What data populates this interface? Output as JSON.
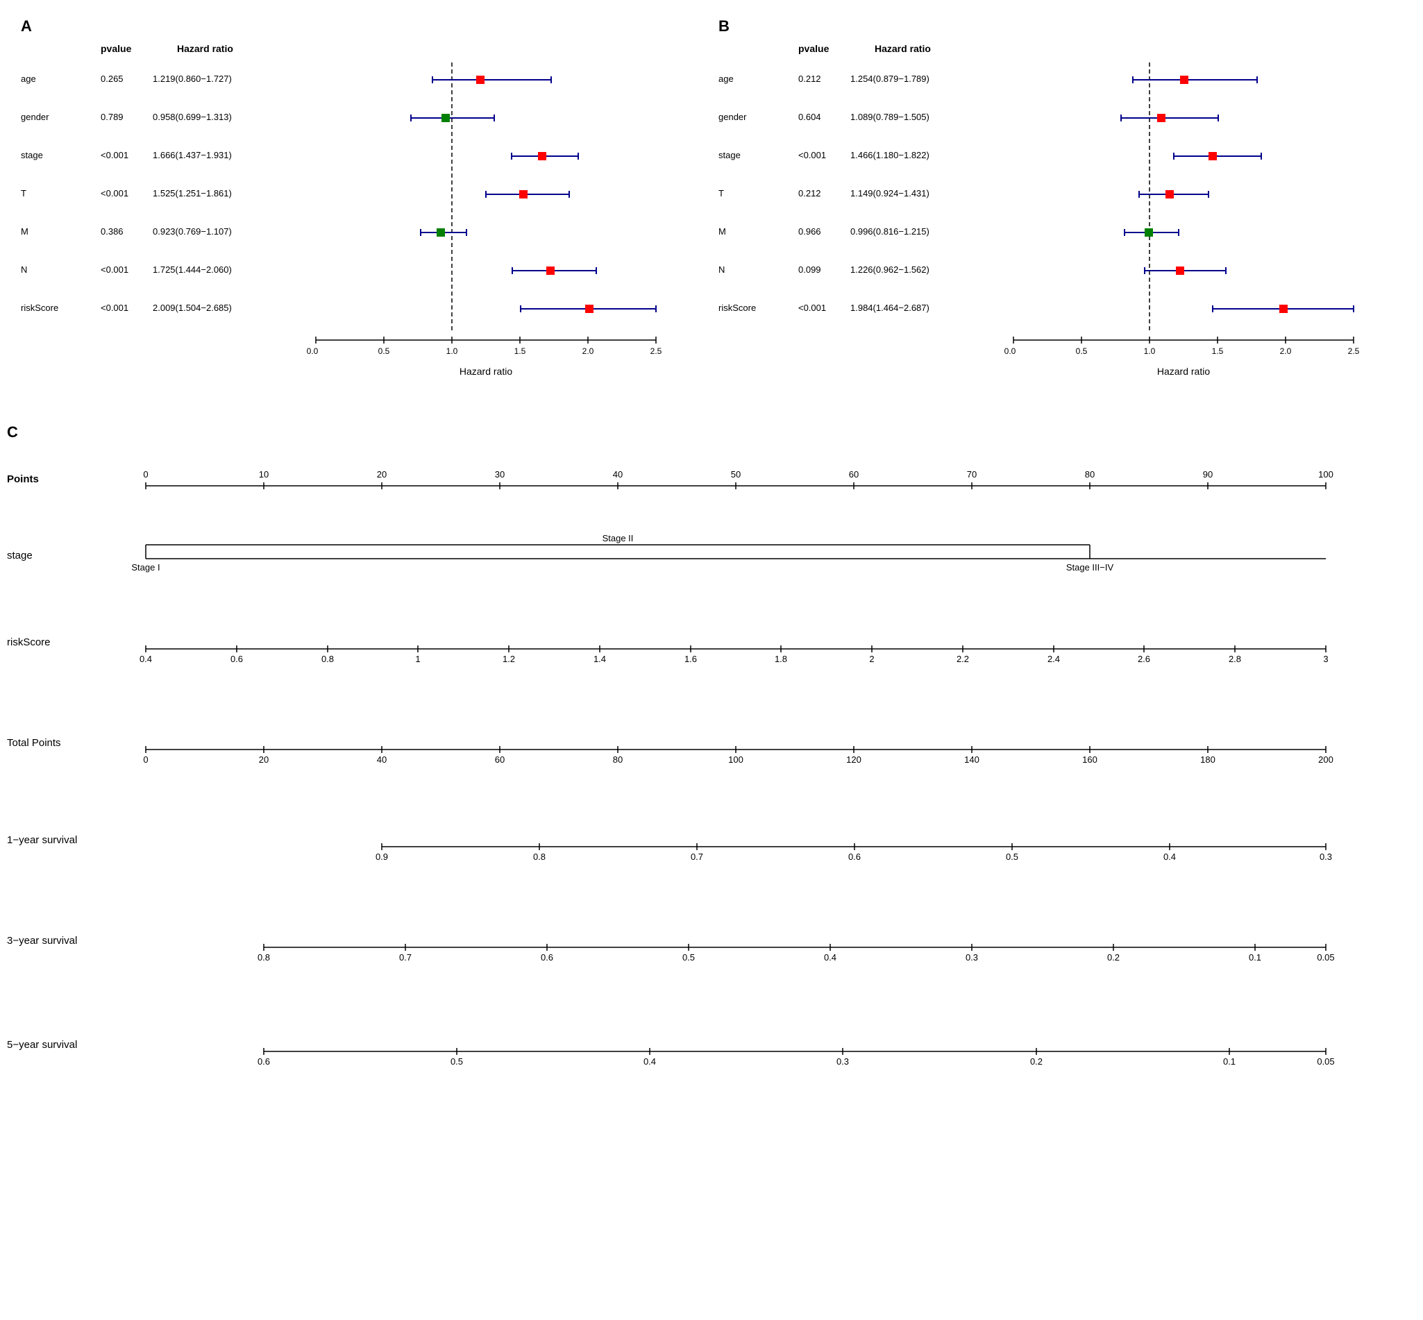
{
  "panels": {
    "A": {
      "label": "A",
      "col_var": "",
      "col_pvalue": "pvalue",
      "col_hr": "Hazard ratio",
      "rows": [
        {
          "var": "age",
          "pval": "0.265",
          "hr": "1.219(0.860−1.727)",
          "est": 1.219,
          "lo": 0.86,
          "hi": 1.727,
          "color": "red"
        },
        {
          "var": "gender",
          "pval": "0.789",
          "hr": "0.958(0.699−1.313)",
          "est": 0.958,
          "lo": 0.699,
          "hi": 1.313,
          "color": "green"
        },
        {
          "var": "stage",
          "pval": "<0.001",
          "hr": "1.666(1.437−1.931)",
          "est": 1.666,
          "lo": 1.437,
          "hi": 1.931,
          "color": "red"
        },
        {
          "var": "T",
          "pval": "<0.001",
          "hr": "1.525(1.251−1.861)",
          "est": 1.525,
          "lo": 1.251,
          "hi": 1.861,
          "color": "red"
        },
        {
          "var": "M",
          "pval": "0.386",
          "hr": "0.923(0.769−1.107)",
          "est": 0.923,
          "lo": 0.769,
          "hi": 1.107,
          "color": "green"
        },
        {
          "var": "N",
          "pval": "<0.001",
          "hr": "1.725(1.444−2.060)",
          "est": 1.725,
          "lo": 1.444,
          "hi": 2.06,
          "color": "red"
        },
        {
          "var": "riskScore",
          "pval": "<0.001",
          "hr": "2.009(1.504−2.685)",
          "est": 2.009,
          "lo": 1.504,
          "hi": 2.685,
          "color": "red"
        }
      ],
      "x_axis": {
        "min": 0.0,
        "max": 2.5,
        "ticks": [
          0.0,
          0.5,
          1.0,
          1.5,
          2.0,
          2.5
        ],
        "label": "Hazard ratio",
        "dashed_line": 1.0
      }
    },
    "B": {
      "label": "B",
      "col_var": "",
      "col_pvalue": "pvalue",
      "col_hr": "Hazard ratio",
      "rows": [
        {
          "var": "age",
          "pval": "0.212",
          "hr": "1.254(0.879−1.789)",
          "est": 1.254,
          "lo": 0.879,
          "hi": 1.789,
          "color": "red"
        },
        {
          "var": "gender",
          "pval": "0.604",
          "hr": "1.089(0.789−1.505)",
          "est": 1.089,
          "lo": 0.789,
          "hi": 1.505,
          "color": "red"
        },
        {
          "var": "stage",
          "pval": "<0.001",
          "hr": "1.466(1.180−1.822)",
          "est": 1.466,
          "lo": 1.18,
          "hi": 1.822,
          "color": "red"
        },
        {
          "var": "T",
          "pval": "0.212",
          "hr": "1.149(0.924−1.431)",
          "est": 1.149,
          "lo": 0.924,
          "hi": 1.431,
          "color": "red"
        },
        {
          "var": "M",
          "pval": "0.966",
          "hr": "0.996(0.816−1.215)",
          "est": 0.996,
          "lo": 0.816,
          "hi": 1.215,
          "color": "green"
        },
        {
          "var": "N",
          "pval": "0.099",
          "hr": "1.226(0.962−1.562)",
          "est": 1.226,
          "lo": 0.962,
          "hi": 1.562,
          "color": "red"
        },
        {
          "var": "riskScore",
          "pval": "<0.001",
          "hr": "1.984(1.464−2.687)",
          "est": 1.984,
          "lo": 1.464,
          "hi": 2.687,
          "color": "red"
        }
      ],
      "x_axis": {
        "min": 0.0,
        "max": 2.5,
        "ticks": [
          0.0,
          0.5,
          1.0,
          1.5,
          2.0,
          2.5
        ],
        "label": "Hazard ratio",
        "dashed_line": 1.0
      }
    }
  },
  "nomogram": {
    "label": "C",
    "rows": [
      {
        "label": "Points",
        "type": "points",
        "ticks": [
          0,
          10,
          20,
          30,
          40,
          50,
          60,
          70,
          80,
          90,
          100
        ],
        "range_start": 0,
        "range_end": 100
      },
      {
        "label": "stage",
        "type": "stage",
        "items": [
          {
            "label": "Stage I",
            "pos": 0.0
          },
          {
            "label": "Stage II",
            "pos": 0.5
          },
          {
            "label": "Stage III−IV",
            "pos": 1.0
          }
        ]
      },
      {
        "label": "riskScore",
        "type": "numeric",
        "ticks": [
          0.4,
          0.6,
          0.8,
          1.0,
          1.2,
          1.4,
          1.6,
          1.8,
          2.0,
          2.2,
          2.4,
          2.6,
          2.8,
          3.0
        ],
        "range_start": 0.4,
        "range_end": 3.0
      },
      {
        "label": "Total Points",
        "type": "numeric",
        "ticks": [
          0,
          20,
          40,
          60,
          80,
          100,
          120,
          140,
          160,
          180,
          200
        ],
        "range_start": 0,
        "range_end": 200
      },
      {
        "label": "1−year survival",
        "type": "numeric",
        "ticks": [
          0.9,
          0.8,
          0.7,
          0.6,
          0.5,
          0.4,
          0.3
        ],
        "range_start": 0.9,
        "range_end": 0.3,
        "axis_start_pct": 0.3
      },
      {
        "label": "3−year survival",
        "type": "numeric",
        "ticks": [
          0.8,
          0.7,
          0.6,
          0.5,
          0.4,
          0.3,
          0.2,
          0.1,
          0.05
        ],
        "range_start": 0.8,
        "range_end": 0.05,
        "axis_start_pct": 0.2
      },
      {
        "label": "5−year survival",
        "type": "numeric",
        "ticks": [
          0.6,
          0.5,
          0.4,
          0.3,
          0.2,
          0.1,
          0.05
        ],
        "range_start": 0.6,
        "range_end": 0.05,
        "axis_start_pct": 0.2
      }
    ]
  }
}
